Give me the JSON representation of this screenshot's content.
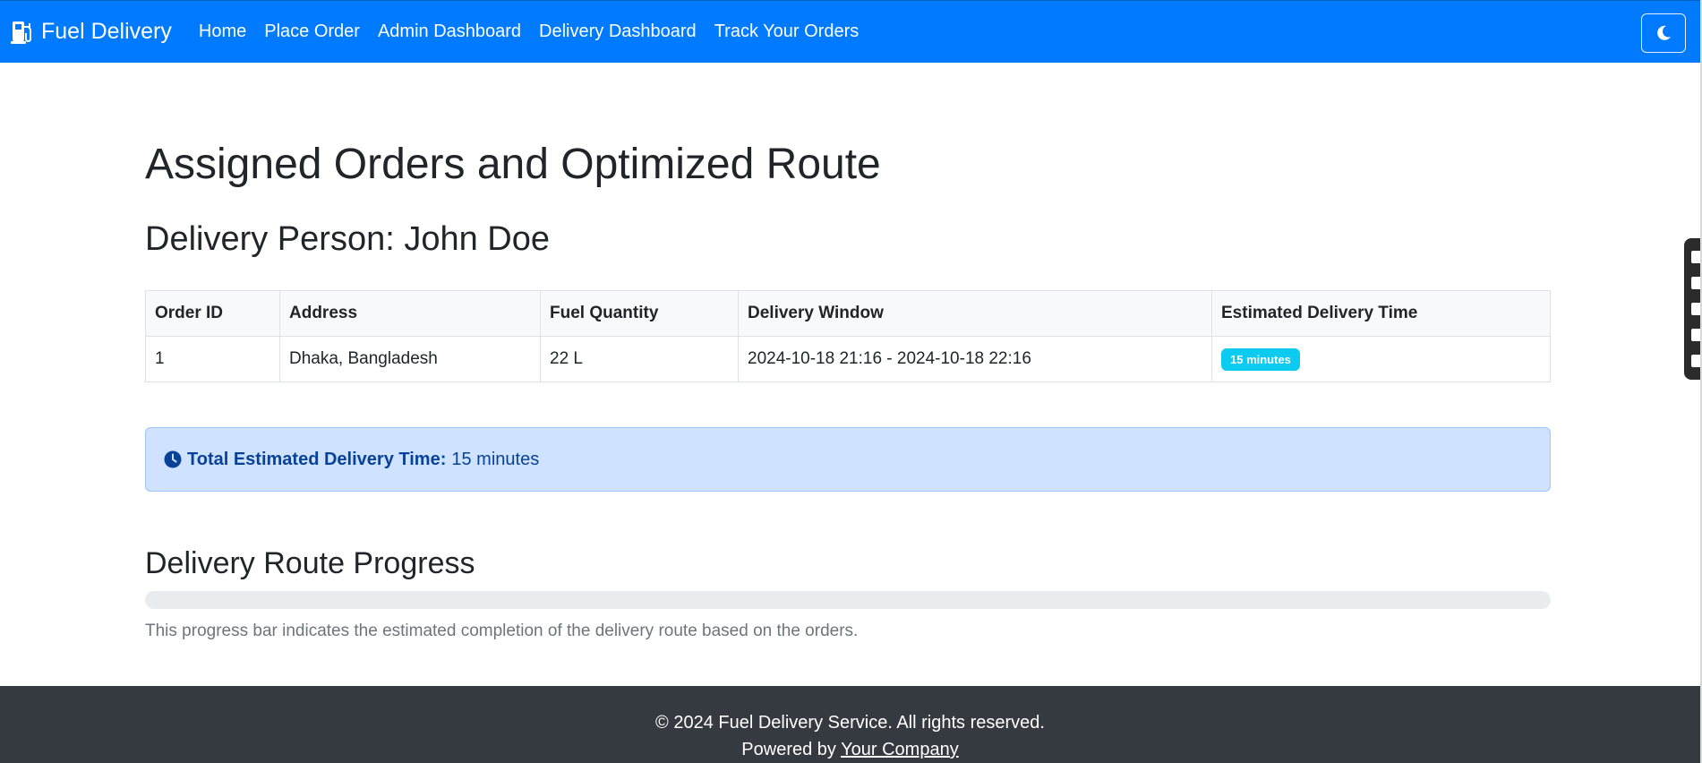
{
  "navbar": {
    "brand": "Fuel Delivery",
    "links": [
      "Home",
      "Place Order",
      "Admin Dashboard",
      "Delivery Dashboard",
      "Track Your Orders"
    ]
  },
  "page": {
    "title": "Assigned Orders and Optimized Route",
    "delivery_person_label": "Delivery Person: John Doe"
  },
  "orders_table": {
    "headers": [
      "Order ID",
      "Address",
      "Fuel Quantity",
      "Delivery Window",
      "Estimated Delivery Time"
    ],
    "rows": [
      {
        "order_id": "1",
        "address": "Dhaka, Bangladesh",
        "fuel_quantity": "22 L",
        "delivery_window": "2024-10-18 21:16 - 2024-10-18 22:16",
        "estimated_time": "15 minutes"
      }
    ]
  },
  "summary": {
    "label": "Total Estimated Delivery Time:",
    "value": "15 minutes"
  },
  "progress": {
    "title": "Delivery Route Progress",
    "percent": 0,
    "note": "This progress bar indicates the estimated completion of the delivery route based on the orders."
  },
  "footer": {
    "copyright": "© 2024 Fuel Delivery Service. All rights reserved.",
    "powered_by": "Powered by",
    "company_link": "Your Company"
  },
  "colors": {
    "primary": "#007bff",
    "info_badge": "#0dcaf0",
    "alert_bg": "#cfe2ff",
    "alert_text": "#084298",
    "footer_bg": "#343a40"
  },
  "icons": [
    "gas-pump-icon",
    "moon-icon",
    "clock-icon"
  ]
}
